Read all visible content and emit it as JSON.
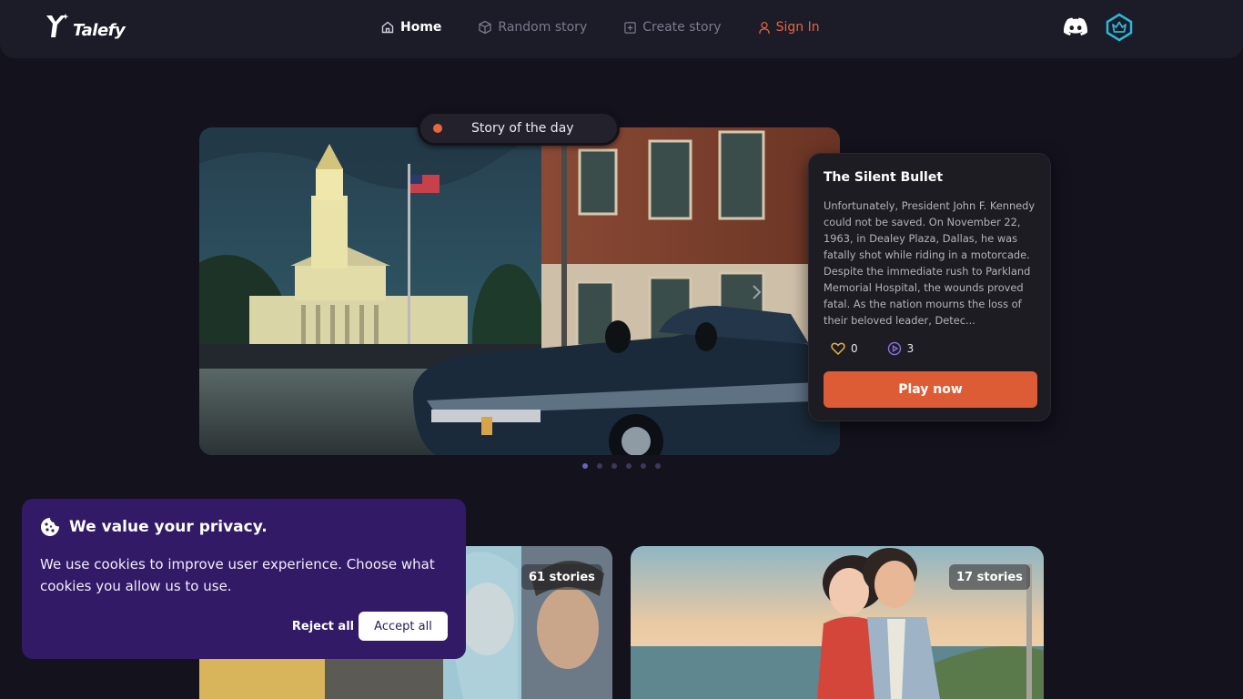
{
  "brand": {
    "name": "Talefy"
  },
  "nav": {
    "home": "Home",
    "random": "Random story",
    "create": "Create story",
    "signin": "Sign In"
  },
  "hero": {
    "badge": "Story of the day",
    "title": "The Silent Bullet",
    "description": "Unfortunately, President John F. Kennedy could not be saved. On November 22, 1963, in Dealey Plaza, Dallas, he was fatally shot while riding in a motorcade. Despite the immediate rush to Parkland Memorial Hospital, the wounds proved fatal. As the nation mourns the loss of their beloved leader, Detec...",
    "likes": "0",
    "plays": "3",
    "play_label": "Play now",
    "slide_count": 6,
    "active_slide": 1
  },
  "categories": [
    {
      "count_label": "61 stories"
    },
    {
      "count_label": "17 stories"
    }
  ],
  "cookie": {
    "title": "We value your privacy.",
    "text": "We use cookies to improve user experience. Choose what cookies you allow us to use.",
    "reject": "Reject all",
    "accept": "Accept all"
  },
  "colors": {
    "accent": "#dd5b35",
    "signin": "#e8663f",
    "cookie_bg": "#321a66",
    "page_bg": "#13121d"
  },
  "icons": [
    "talefy-logo-icon",
    "home-icon",
    "cube-icon",
    "plus-square-icon",
    "user-icon",
    "discord-icon",
    "crown-icon",
    "chevron-right-icon",
    "heart-icon",
    "play-circle-icon",
    "cookie-icon"
  ]
}
